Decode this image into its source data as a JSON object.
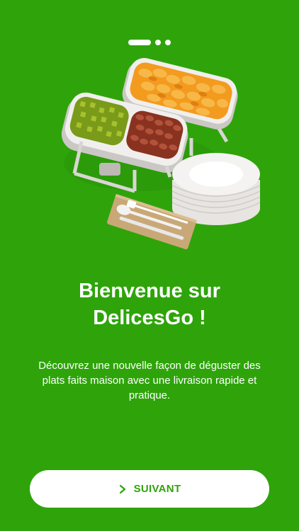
{
  "pager": {
    "total": 3,
    "active_index": 0
  },
  "illustration": {
    "icon": "buffet-food-trays-illustration"
  },
  "welcome": {
    "title": "Bienvenue sur\nDelicesGo !",
    "subtitle": "Découvrez une nouvelle façon de déguster des plats faits maison avec une livraison rapide et pratique."
  },
  "next_button": {
    "label": "SUIVANT",
    "icon": "chevron-right-icon"
  },
  "colors": {
    "background": "#2ea40a",
    "button_background": "#ffffff",
    "button_text": "#2ea40a"
  }
}
